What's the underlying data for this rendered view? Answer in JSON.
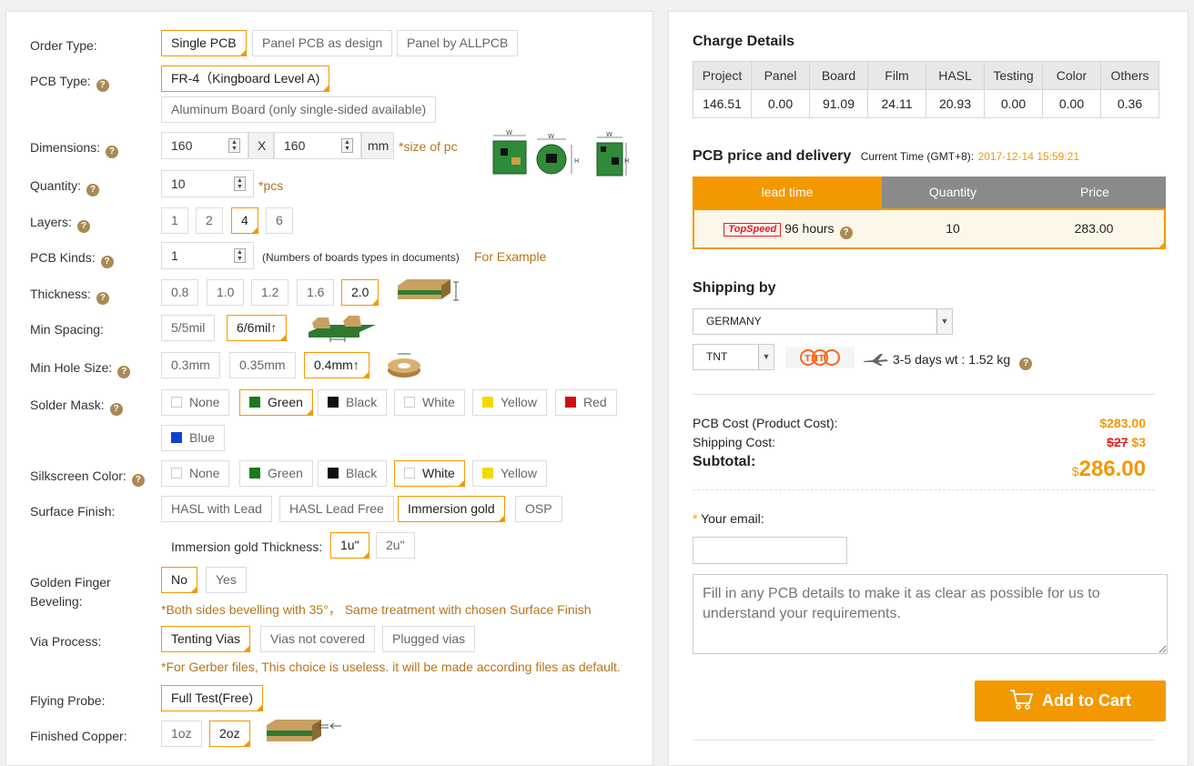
{
  "form": {
    "order_type": {
      "label": "Order Type:",
      "options": [
        "Single PCB",
        "Panel PCB as design",
        "Panel by ALLPCB"
      ],
      "selected": 0
    },
    "pcb_type": {
      "label": "PCB Type:",
      "options": [
        "FR-4（Kingboard Level A)",
        "Aluminum Board (only single-sided available)"
      ],
      "selected": 0
    },
    "dimensions": {
      "label": "Dimensions:",
      "width": "160",
      "x_label": "X",
      "height": "160",
      "unit": "mm",
      "note": "*size of pc"
    },
    "quantity": {
      "label": "Quantity:",
      "value": "10",
      "unit": "*pcs"
    },
    "layers": {
      "label": "Layers:",
      "options": [
        "1",
        "2",
        "4",
        "6"
      ],
      "selected": 2
    },
    "pcb_kinds": {
      "label": "PCB Kinds:",
      "value": "1",
      "note": "(Numbers of boards types in documents)",
      "example_link": "For Example"
    },
    "thickness": {
      "label": "Thickness:",
      "options": [
        "0.8",
        "1.0",
        "1.2",
        "1.6",
        "2.0"
      ],
      "selected": 4
    },
    "min_spacing": {
      "label": "Min Spacing:",
      "options": [
        "5/5mil",
        "6/6mil↑"
      ],
      "selected": 1
    },
    "min_hole": {
      "label": "Min Hole Size:",
      "options": [
        "0.3mm",
        "0.35mm",
        "0.4mm↑"
      ],
      "selected": 2
    },
    "solder_mask": {
      "label": "Solder Mask:",
      "options": [
        "None",
        "Green",
        "Black",
        "White",
        "Yellow",
        "Red",
        "Blue"
      ],
      "colors": [
        "#ffffff",
        "#1a7a1a",
        "#111111",
        "#ffffff",
        "#f5d800",
        "#cc1111",
        "#1144cc"
      ],
      "selected": 1
    },
    "silkscreen": {
      "label": "Silkscreen Color:",
      "options": [
        "None",
        "Green",
        "Black",
        "White",
        "Yellow"
      ],
      "colors": [
        "#ffffff",
        "#1a7a1a",
        "#111111",
        "#ffffff",
        "#f5d800"
      ],
      "selected": 3
    },
    "surface_finish": {
      "label": "Surface Finish:",
      "options": [
        "HASL with Lead",
        "HASL Lead Free",
        "Immersion gold",
        "OSP"
      ],
      "selected": 2
    },
    "gold_thickness": {
      "label": "Immersion gold Thickness:",
      "options": [
        "1u\"",
        "2u\""
      ],
      "selected": 0
    },
    "golden_finger": {
      "label_1": "Golden Finger",
      "label_2": "Beveling:",
      "options": [
        "No",
        "Yes"
      ],
      "selected": 0,
      "note": "*Both sides bevelling with 35°， Same treatment with chosen Surface Finish"
    },
    "via_process": {
      "label": "Via Process:",
      "options": [
        "Tenting Vias",
        "Vias not covered",
        "Plugged vias"
      ],
      "selected": 0,
      "note": "*For Gerber files, This choice is useless. it will be made according files as default."
    },
    "flying_probe": {
      "label": "Flying Probe:",
      "options": [
        "Full Test(Free)"
      ],
      "selected": 0
    },
    "finished_copper": {
      "label": "Finished Copper:",
      "options": [
        "1oz",
        "2oz"
      ],
      "selected": 1
    }
  },
  "charge": {
    "title": "Charge Details",
    "headers": [
      "Project",
      "Panel",
      "Board",
      "Film",
      "HASL",
      "Testing",
      "Color",
      "Others"
    ],
    "values": [
      "146.51",
      "0.00",
      "91.09",
      "24.11",
      "20.93",
      "0.00",
      "0.00",
      "0.36"
    ]
  },
  "delivery": {
    "title": "PCB price and delivery",
    "time_label": "Current Time (GMT+8):",
    "time_value": "2017-12-14 15:59:21",
    "headers": [
      "lead time",
      "Quantity",
      "Price"
    ],
    "badge": "TopSpeed",
    "lead": "96 hours",
    "quantity": "10",
    "price": "283.00"
  },
  "shipping": {
    "title": "Shipping by",
    "country": "GERMANY",
    "carrier": "TNT",
    "carrier_logo": "TNT",
    "estimate": "3-5 days wt : 1.52 kg"
  },
  "costs": {
    "pcb_label": "PCB Cost (Product Cost):",
    "pcb_value": "$283.00",
    "ship_label": "Shipping Cost:",
    "ship_old": "$27",
    "ship_new": "$3",
    "subtotal_label": "Subtotal:",
    "currency": "$",
    "subtotal_value": "286.00"
  },
  "email": {
    "label": "Your email:",
    "required_mark": "*",
    "value": "",
    "details_placeholder": "Fill in any PCB details to make it as clear as possible for us to understand your requirements."
  },
  "cart": {
    "label": "Add to Cart"
  },
  "colors": {
    "accent": "#f39800",
    "gray_header": "#8a8a8a",
    "note": "#b8741a"
  }
}
